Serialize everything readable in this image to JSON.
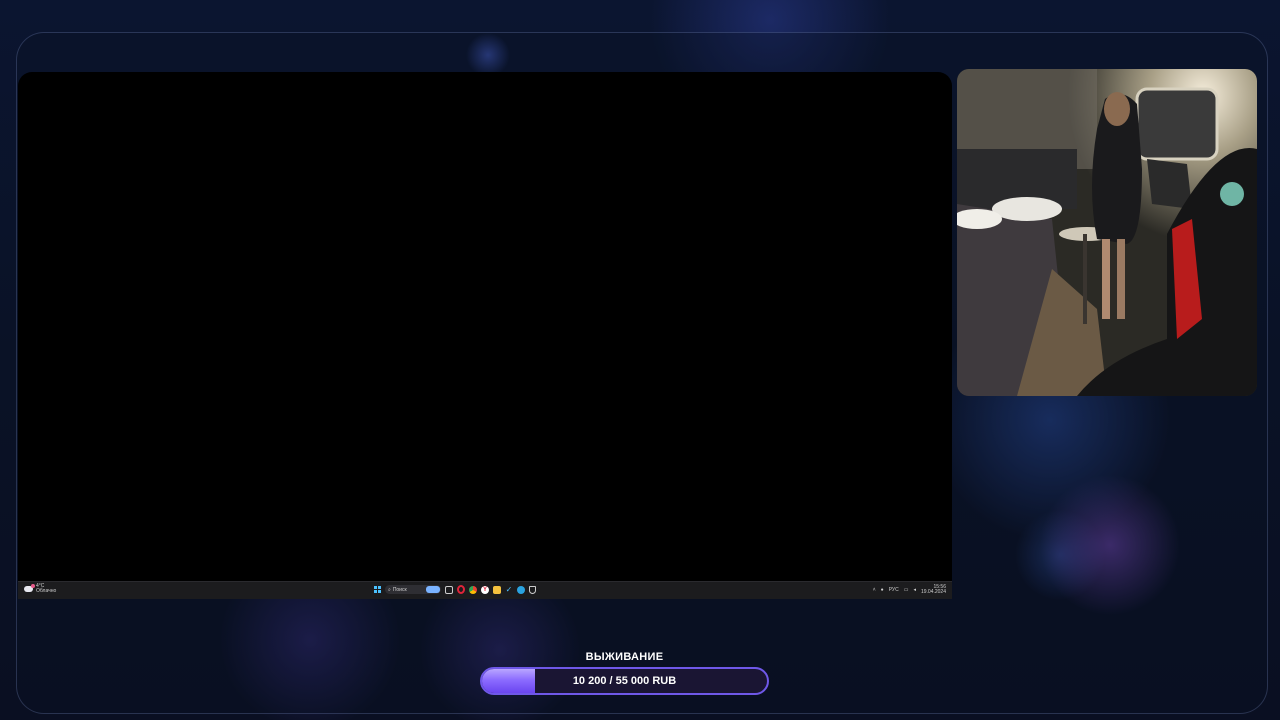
{
  "taskbar": {
    "weather_temp": "4°C",
    "weather_desc": "Облачно",
    "search_placeholder": "Поиск",
    "language": "РУС",
    "time": "15:56",
    "date": "19.04.2024"
  },
  "goal": {
    "title": "ВЫЖИВАНИЕ",
    "progress_text": "10 200 / 55 000 RUB",
    "current": 10200,
    "target": 55000,
    "currency": "RUB"
  },
  "colors": {
    "accent": "#7c5cff",
    "taskbar": "#1c1c1e",
    "background": "#0b1530"
  }
}
